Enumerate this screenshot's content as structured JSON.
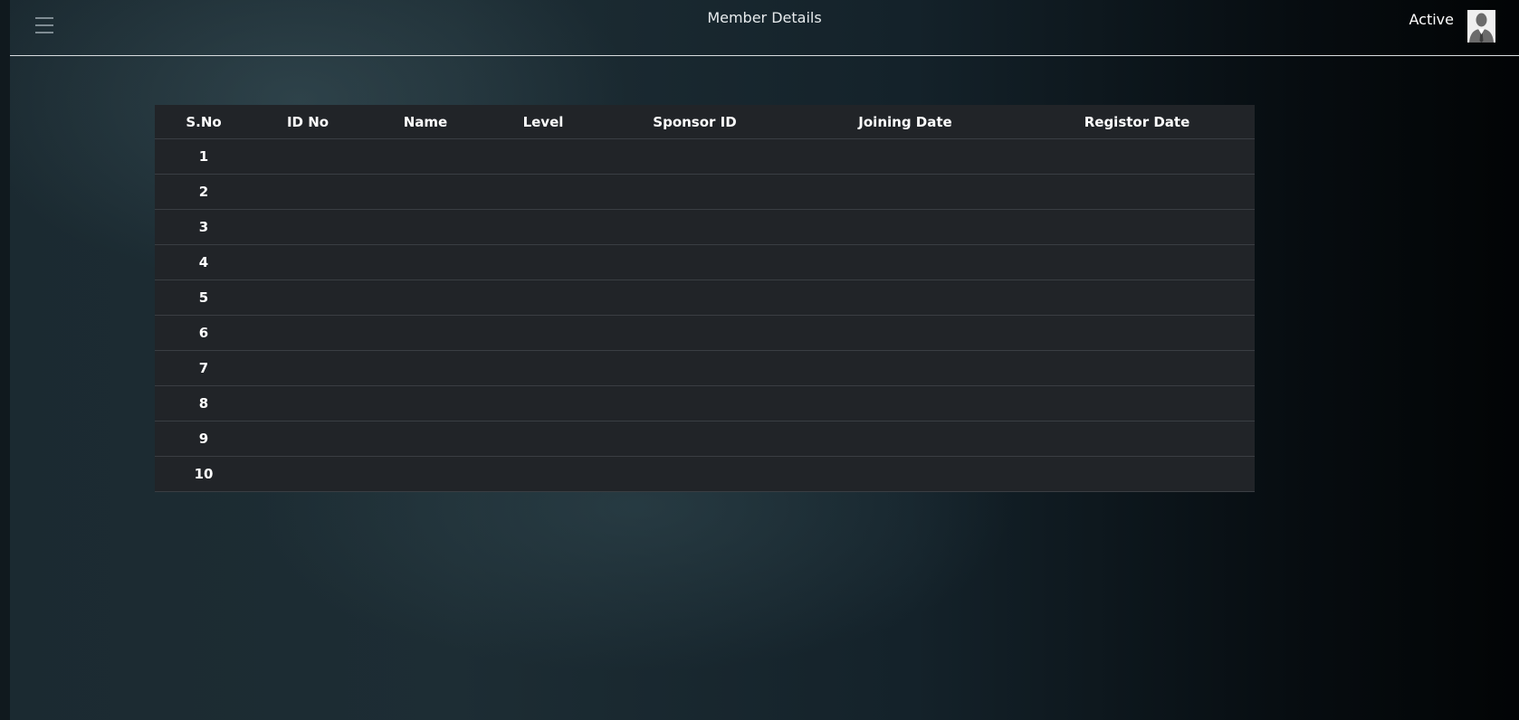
{
  "header": {
    "title": "Member Details",
    "status": "Active",
    "menu_icon": "hamburger-menu-icon",
    "avatar_icon": "user-avatar-icon"
  },
  "table": {
    "columns": [
      "S.No",
      "ID No",
      "Name",
      "Level",
      "Sponsor ID",
      "Joining Date",
      "Registor Date"
    ],
    "rows": [
      [
        "1",
        "",
        "",
        "",
        "",
        "",
        ""
      ],
      [
        "2",
        "",
        "",
        "",
        "",
        "",
        ""
      ],
      [
        "3",
        "",
        "",
        "",
        "",
        "",
        ""
      ],
      [
        "4",
        "",
        "",
        "",
        "",
        "",
        ""
      ],
      [
        "5",
        "",
        "",
        "",
        "",
        "",
        ""
      ],
      [
        "6",
        "",
        "",
        "",
        "",
        "",
        ""
      ],
      [
        "7",
        "",
        "",
        "",
        "",
        "",
        ""
      ],
      [
        "8",
        "",
        "",
        "",
        "",
        "",
        ""
      ],
      [
        "9",
        "",
        "",
        "",
        "",
        "",
        ""
      ],
      [
        "10",
        "",
        "",
        "",
        "",
        "",
        ""
      ]
    ]
  }
}
